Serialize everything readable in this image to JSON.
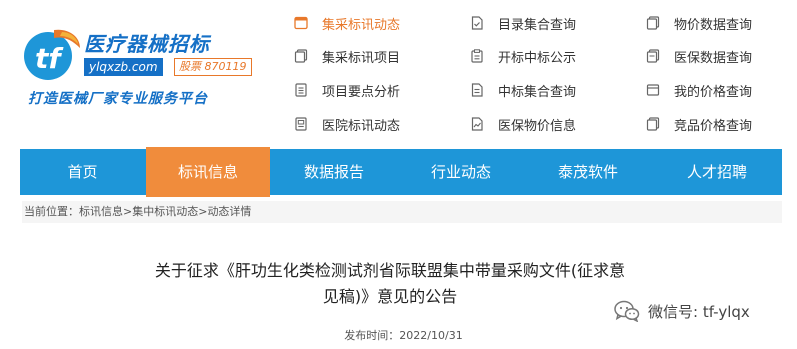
{
  "logo": {
    "mark": "tf",
    "title": "医疗器械招标",
    "domain": "ylqxzb.com",
    "stock": "股票 870119",
    "slogan": "打造医械厂家专业服务平台"
  },
  "quick_links": [
    [
      {
        "label": "集采标讯动态",
        "icon": "document-folder-icon",
        "active": true
      },
      {
        "label": "集采标讯项目",
        "icon": "document-copy-icon",
        "active": false
      },
      {
        "label": "项目要点分析",
        "icon": "list-document-icon",
        "active": false
      },
      {
        "label": "医院标讯动态",
        "icon": "grid-document-icon",
        "active": false
      }
    ],
    [
      {
        "label": "目录集合查询",
        "icon": "file-check-icon",
        "active": false
      },
      {
        "label": "开标中标公示",
        "icon": "clipboard-icon",
        "active": false
      },
      {
        "label": "中标集合查询",
        "icon": "file-list-icon",
        "active": false
      },
      {
        "label": "医保物价信息",
        "icon": "file-chart-icon",
        "active": false
      }
    ],
    [
      {
        "label": "物价数据查询",
        "icon": "document-copy-icon",
        "active": false
      },
      {
        "label": "医保数据查询",
        "icon": "document-stack-icon",
        "active": false
      },
      {
        "label": "我的价格查询",
        "icon": "window-icon",
        "active": false
      },
      {
        "label": "竞品价格查询",
        "icon": "document-copy-icon",
        "active": false
      }
    ]
  ],
  "nav": [
    {
      "label": "首页",
      "active": false
    },
    {
      "label": "标讯信息",
      "active": true
    },
    {
      "label": "数据报告",
      "active": false
    },
    {
      "label": "行业动态",
      "active": false
    },
    {
      "label": "泰茂软件",
      "active": false
    },
    {
      "label": "人才招聘",
      "active": false
    }
  ],
  "breadcrumb": {
    "prefix": "当前位置：",
    "items": [
      "标讯信息",
      "集中标讯动态",
      "动态详情"
    ],
    "separator": ">"
  },
  "article": {
    "title_line1": "关于征求《肝功生化类检测试剂省际联盟集中带量采购文件(征求意",
    "title_line2": "见稿)》意见的公告",
    "date_label": "发布时间：",
    "date": "2022/10/31"
  },
  "watermark": {
    "text": "微信号: tf-ylqx"
  },
  "colors": {
    "nav_blue": "#1e96d8",
    "nav_active_orange": "#f08c3c",
    "brand_blue": "#1570c6",
    "link_active": "#e8782a"
  }
}
